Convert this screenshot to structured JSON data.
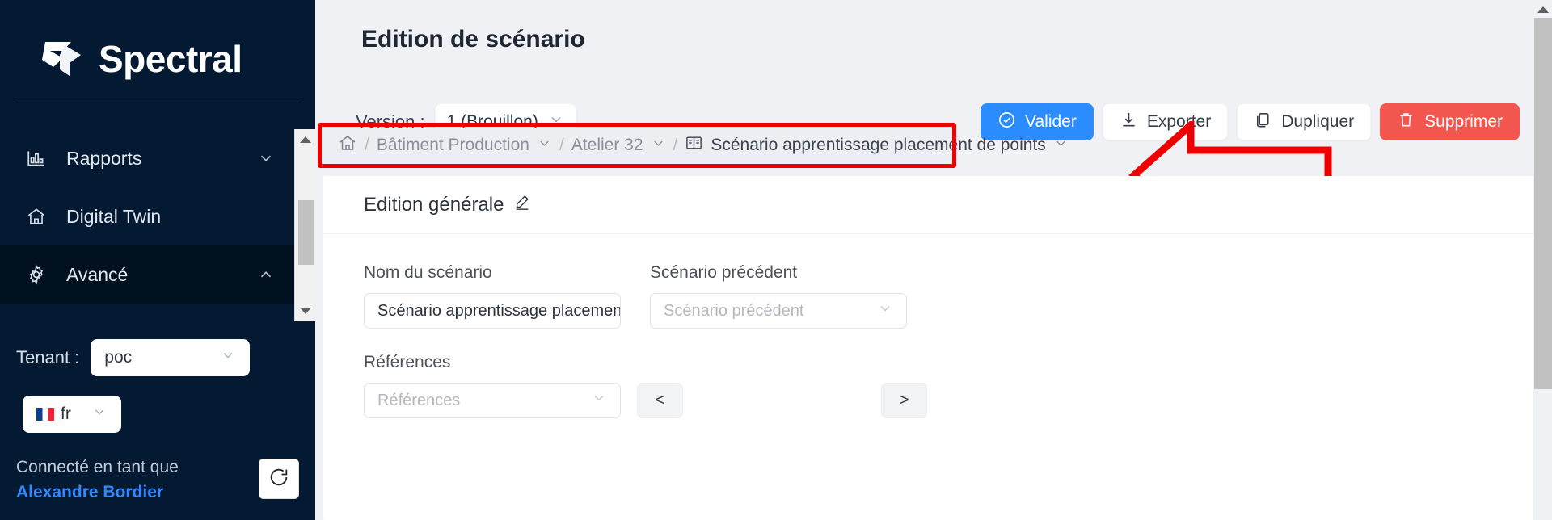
{
  "sidebar": {
    "brand": "Spectral",
    "nav_items": [
      {
        "label": "Rapports",
        "icon": "chart-bar-icon",
        "chevron": "chevron-down-icon"
      },
      {
        "label": "Digital Twin",
        "icon": "home-icon",
        "chevron": ""
      },
      {
        "label": "Avancé",
        "icon": "gear-icon",
        "chevron": "chevron-up-icon"
      }
    ],
    "tenant_label": "Tenant :",
    "tenant_value": "poc",
    "language_value": "fr",
    "connected_label": "Connecté en tant que",
    "user_name": "Alexandre Bordier",
    "logout_icon": "logout-icon"
  },
  "header": {
    "page_title": "Edition de scénario",
    "version_label": "Version  :",
    "version_value": "1 (Brouillon)"
  },
  "actions": {
    "validate": "Valider",
    "export": "Exporter",
    "duplicate": "Dupliquer",
    "delete": "Supprimer"
  },
  "breadcrumb": {
    "home_icon": "home-icon",
    "separator": "/",
    "items": [
      {
        "label": "Bâtiment Production",
        "has_chevron": true
      },
      {
        "label": "Atelier 32",
        "has_chevron": true
      }
    ],
    "current": "Scénario apprentissage placement de points",
    "current_icon": "book-icon",
    "highlight_color": "#ef0000"
  },
  "card": {
    "title": "Edition générale",
    "edit_icon": "pencil-icon",
    "fields": {
      "name_label": "Nom du scénario",
      "name_value": "Scénario apprentissage placement de",
      "previous_label": "Scénario précédent",
      "previous_placeholder": "Scénario précédent",
      "references_label": "Références",
      "references_placeholder": "Références",
      "prev_button": "<",
      "next_button": ">"
    }
  },
  "colors": {
    "sidebar_bg": "#041a33",
    "primary": "#2b8cff",
    "danger": "#f2564f",
    "accent_link": "#2f8aff"
  }
}
